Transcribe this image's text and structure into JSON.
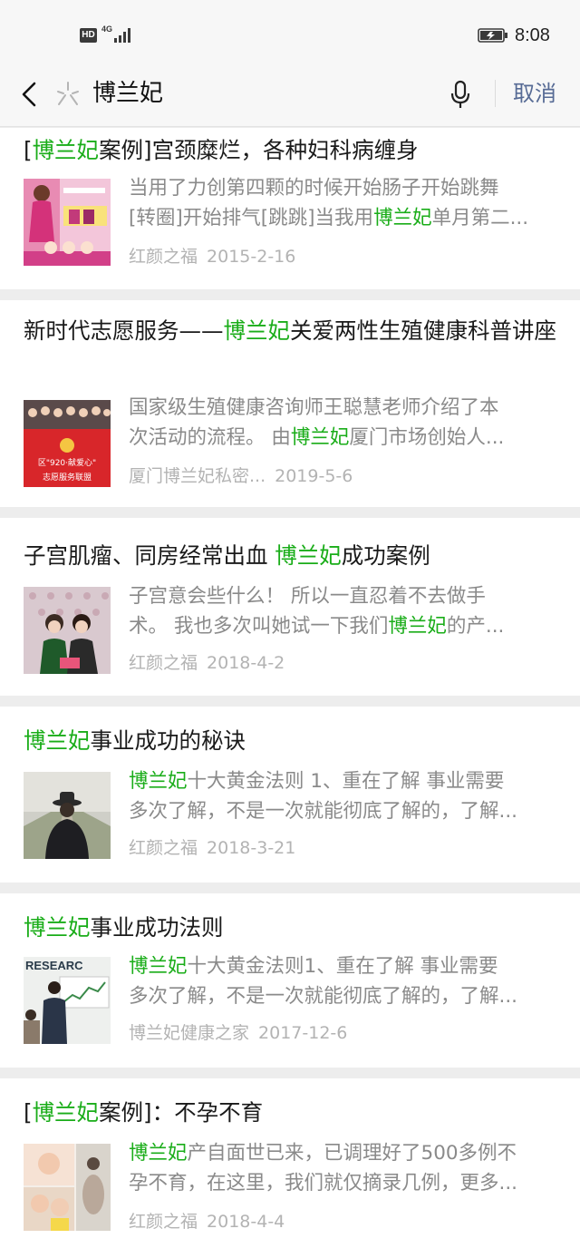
{
  "status_bar": {
    "hd": "HD",
    "network": "4G",
    "time": "8:08"
  },
  "search_bar": {
    "query": "博兰妃",
    "cancel_label": "取消"
  },
  "results": [
    {
      "title_parts": [
        [
          "[",
          false
        ],
        [
          "博兰妃",
          true
        ],
        [
          "案例]宫颈糜烂，各种妇科病缠身",
          false
        ]
      ],
      "snippet_lines": [
        [
          [
            "当用了力创第四颗的时候开始肠子开始跳舞",
            false
          ]
        ],
        [
          [
            "[转圈]开始排气[跳跳]当我用",
            false
          ],
          [
            "博兰妃",
            true
          ],
          [
            "单月第二...",
            false
          ]
        ]
      ],
      "source": "红颜之福",
      "date": "2015-2-16",
      "thumb_icon": "pink-product-ad-thumbnail"
    },
    {
      "title_parts": [
        [
          "新时代志愿服务——",
          false
        ],
        [
          "博兰妃",
          true
        ],
        [
          "关爱两性生殖健康科普讲座",
          false
        ]
      ],
      "snippet_lines": [
        [
          [
            "国家级生殖健康咨询师王聪慧老师介绍了本",
            false
          ]
        ],
        [
          [
            "次活动的流程。 由",
            false
          ],
          [
            "博兰妃",
            true
          ],
          [
            "厦门市场创始人...",
            false
          ]
        ]
      ],
      "source": "厦门博兰妃私密...",
      "date": "2019-5-6",
      "thumb_icon": "group-photo-banner-thumbnail",
      "thumb_banner_text": "区\"920·献爱心\"",
      "thumb_banner_text2": "志愿服务联盟"
    },
    {
      "title_parts": [
        [
          "子宫肌瘤、同房经常出血 ",
          false
        ],
        [
          "博兰妃",
          true
        ],
        [
          "成功案例",
          false
        ]
      ],
      "snippet_lines": [
        [
          [
            "子宫意会些什么！ 所以一直忍着不去做手",
            false
          ]
        ],
        [
          [
            "术。 我也多次叫她试一下我们",
            false
          ],
          [
            "博兰妃",
            true
          ],
          [
            "的产...",
            false
          ]
        ]
      ],
      "source": "红颜之福",
      "date": "2018-4-2",
      "thumb_icon": "two-women-photo-thumbnail"
    },
    {
      "title_parts": [
        [
          "博兰妃",
          true
        ],
        [
          "事业成功的秘诀",
          false
        ]
      ],
      "snippet_lines": [
        [
          [
            "博兰妃",
            true
          ],
          [
            "十大黄金法则 1、重在了解 事业需要",
            false
          ]
        ],
        [
          [
            "多次了解，不是一次就能彻底了解的，了解...",
            false
          ]
        ]
      ],
      "source": "红颜之福",
      "date": "2018-3-21",
      "thumb_icon": "man-crossroads-thumbnail"
    },
    {
      "title_parts": [
        [
          "博兰妃",
          true
        ],
        [
          "事业成功法则",
          false
        ]
      ],
      "snippet_lines": [
        [
          [
            "博兰妃",
            true
          ],
          [
            "十大黄金法则1、重在了解 事业需要",
            false
          ]
        ],
        [
          [
            "多次了解，不是一次就能彻底了解的，了解...",
            false
          ]
        ]
      ],
      "source": "博兰妃健康之家",
      "date": "2017-12-6",
      "thumb_icon": "research-presentation-thumbnail",
      "thumb_banner_text": "RESEARC"
    },
    {
      "title_parts": [
        [
          "[",
          false
        ],
        [
          "博兰妃",
          true
        ],
        [
          "案例]：不孕不育",
          false
        ]
      ],
      "snippet_lines": [
        [
          [
            "博兰妃",
            true
          ],
          [
            "产自面世已来，已调理好了500多例不",
            false
          ]
        ],
        [
          [
            "孕不育，在这里，我们就仅摘录几例，更多...",
            false
          ]
        ]
      ],
      "source": "红颜之福",
      "date": "2018-4-4",
      "thumb_icon": "baby-collage-thumbnail"
    }
  ],
  "colors": {
    "highlight": "#1aad19",
    "cancel": "#576b95",
    "snippet": "#8a8a8a",
    "meta": "#b3b3b3",
    "background": "#ededed"
  }
}
